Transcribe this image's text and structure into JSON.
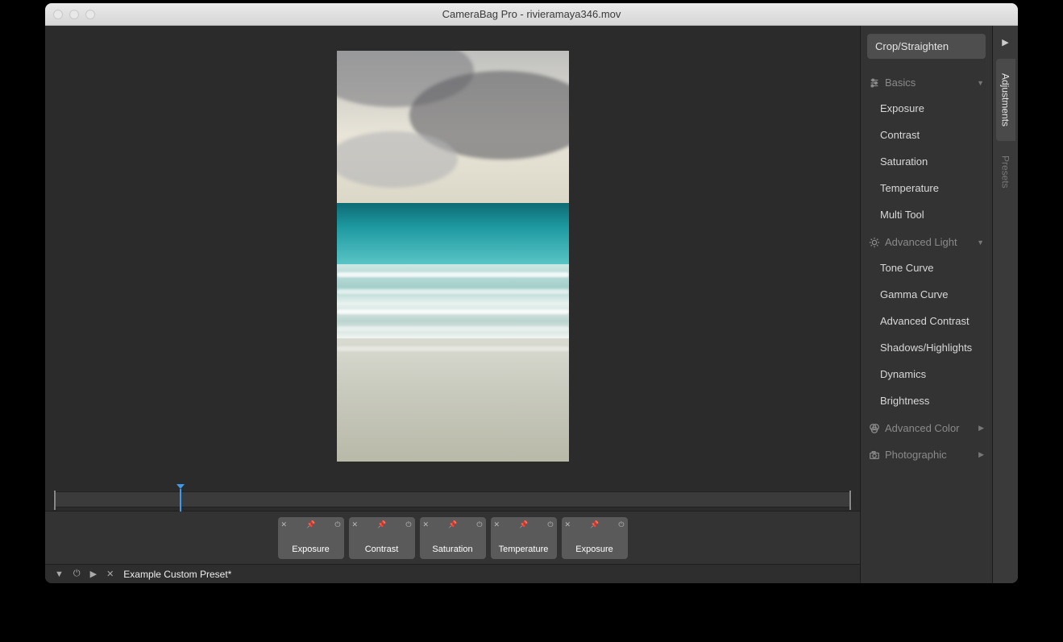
{
  "window": {
    "title": "CameraBag Pro - rivieramaya346.mov"
  },
  "sidebar": {
    "crop_label": "Crop/Straighten",
    "sections": [
      {
        "name": "basics",
        "label": "Basics",
        "expanded": true,
        "items": [
          "Exposure",
          "Contrast",
          "Saturation",
          "Temperature",
          "Multi Tool"
        ]
      },
      {
        "name": "advanced-light",
        "label": "Advanced Light",
        "expanded": true,
        "items": [
          "Tone Curve",
          "Gamma Curve",
          "Advanced Contrast",
          "Shadows/Highlights",
          "Dynamics",
          "Brightness"
        ]
      },
      {
        "name": "advanced-color",
        "label": "Advanced Color",
        "expanded": false,
        "items": []
      },
      {
        "name": "photographic",
        "label": "Photographic",
        "expanded": false,
        "items": []
      }
    ]
  },
  "tab_rail": {
    "tabs": [
      {
        "label": "Adjustments",
        "active": true
      },
      {
        "label": "Presets",
        "active": false
      }
    ]
  },
  "timeline": {
    "playhead_percent": 15.8
  },
  "tiles": [
    {
      "label": "Exposure"
    },
    {
      "label": "Contrast"
    },
    {
      "label": "Saturation"
    },
    {
      "label": "Temperature"
    },
    {
      "label": "Exposure"
    }
  ],
  "footer": {
    "preset_name": "Example Custom Preset*"
  }
}
